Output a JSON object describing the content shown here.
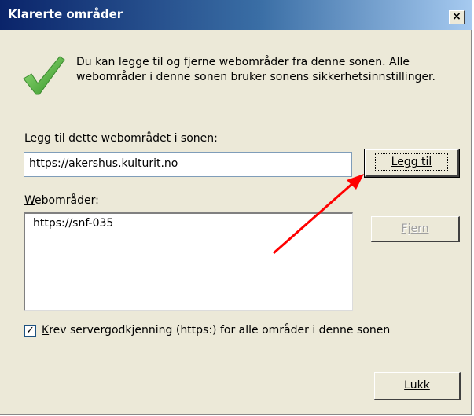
{
  "window": {
    "title": "Klarerte områder",
    "close_label": "×"
  },
  "info": {
    "text": "Du kan legge til og fjerne webområder fra denne sonen. Alle webområder i denne sonen bruker sonens sikkerhetsinnstillinger."
  },
  "add_site": {
    "label": "Legg til dette webområdet i sonen:",
    "value": "https://akershus.kulturit.no",
    "button_label": "Legg til"
  },
  "websites": {
    "label_first": "W",
    "label_rest": "ebområder:",
    "items": [
      "https://snf-035"
    ],
    "remove_label": "Fjern"
  },
  "require_https": {
    "checked": true,
    "mark": "✓",
    "label_first": "K",
    "label_rest": "rev servergodkjenning (https:) for alle områder i denne sonen"
  },
  "footer": {
    "close_button_label": "Lukk"
  },
  "colors": {
    "annotation_arrow": "#ff0000",
    "check_icon": "#4caf3a"
  },
  "icons": [
    "checkmark-icon",
    "close-icon",
    "annotation-arrow"
  ]
}
